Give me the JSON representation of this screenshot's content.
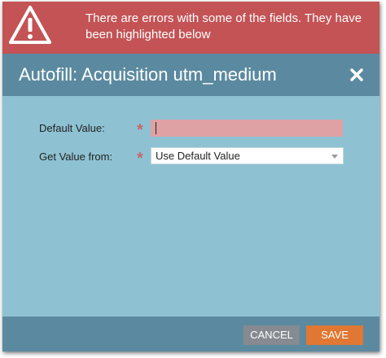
{
  "error_banner": {
    "icon": "warning-icon",
    "message": "There are errors with some of the fields. They have been highlighted below",
    "color": "#c35355"
  },
  "dialog": {
    "title": "Autofill: Acquisition utm_medium",
    "close_icon": "close-icon",
    "header_color": "#5b8aa0",
    "body_color": "#8ec2d3"
  },
  "form": {
    "default_value": {
      "label": "Default Value:",
      "required_marker": "*",
      "value": "",
      "error_color": "#dfa1a4"
    },
    "get_value_from": {
      "label": "Get Value from:",
      "required_marker": "*",
      "selected": "Use Default Value",
      "icon": "chevron-down-icon"
    }
  },
  "footer": {
    "cancel_label": "CANCEL",
    "save_label": "SAVE",
    "save_color": "#e07732",
    "cancel_color": "#858b90"
  }
}
